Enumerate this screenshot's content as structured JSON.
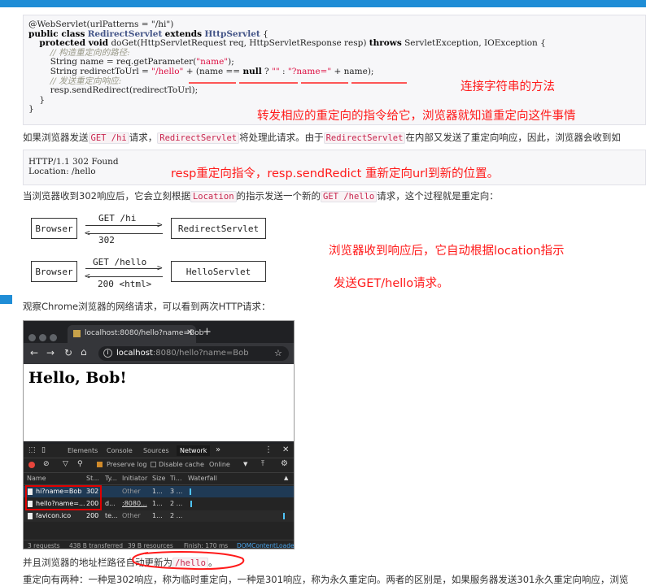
{
  "code1": {
    "l1": "@WebServlet(urlPatterns = \"/hi\")",
    "l2_kw": "public class",
    "l2_cls": "RedirectServlet",
    "l2_ext": "extends",
    "l2_base": "HttpServlet",
    "l2_end": " {",
    "l3_kw": "protected void",
    "l3_rest": " doGet(HttpServletRequest req, HttpServletResponse resp) ",
    "l3_throws": "throws",
    "l3_exc": " ServletException, IOException {",
    "l4": "// 构造重定向的路径:",
    "l5_a": "String name = req.getParameter(",
    "l5_s": "\"name\"",
    "l5_b": ");",
    "l6_a": "String redirectToUrl = ",
    "l6_s1": "\"/hello\"",
    "l6_b": " + (name == ",
    "l6_null": "null",
    "l6_c": " ? ",
    "l6_s2": "\"\"",
    "l6_d": " : ",
    "l6_s3": "\"?name=\"",
    "l6_e": " + name);",
    "l7": "// 发送重定向响应:",
    "l8": "resp.sendRedirect(redirectToUrl);",
    "l9": "}",
    "l10": "}"
  },
  "annotations": {
    "a1": "连接字符串的方法",
    "a2": "转发相应的重定向的指令给它，浏览器就知道重定向这件事情",
    "a3": "resp重定向指令，resp.sendRedict  重新定向url到新的位置。",
    "a4": "浏览器收到响应后，它自动根据location指示",
    "a5": "发送GET/hello请求。"
  },
  "para1": {
    "t1": "如果浏览器发送",
    "c1": "GET /hi",
    "t2": "请求，",
    "c2": "RedirectServlet",
    "t3": "将处理此请求。由于",
    "c3": "RedirectServlet",
    "t4": "在内部又发送了重定向响应，因此，浏览器会收到如"
  },
  "code2": {
    "l1": "HTTP/1.1 302 Found",
    "l2": "Location: /hello"
  },
  "para2": {
    "t1": "当浏览器收到302响应后，它会立刻根据",
    "c1": "Location",
    "t2": "的指示发送一个新的",
    "c2": "GET /hello",
    "t3": "请求，这个过程就是重定向："
  },
  "diagram": {
    "browser1": "Browser",
    "req1": "GET /hi",
    "resp1": "302",
    "server1": "RedirectServlet",
    "browser2": "Browser",
    "req2": "GET /hello",
    "resp2": "200 <html>",
    "server2": "HelloServlet"
  },
  "para3": "观察Chrome浏览器的网络请求，可以看到两次HTTP请求：",
  "browser": {
    "tab_title": "localhost:8080/hello?name=Bob",
    "url_host": "localhost",
    "url_rest": ":8080/hello?name=Bob",
    "page_heading": "Hello, Bob!",
    "devtools_tabs": [
      "Elements",
      "Console",
      "Sources",
      "Network"
    ],
    "active_tab": "Network",
    "more": "»",
    "preserve_log": "Preserve log",
    "disable_cache": "Disable cache",
    "throttle": "Online",
    "columns": [
      "Name",
      "St...",
      "Ty...",
      "Initiator",
      "Size",
      "Ti...",
      "Waterfall"
    ],
    "rows": [
      [
        "hi?name=Bob",
        "302",
        "",
        "Other",
        "1...",
        "3 ..."
      ],
      [
        "hello?name=...",
        "200",
        "d...",
        ":8080...",
        "1...",
        "2 ..."
      ],
      [
        "favicon.ico",
        "200",
        "te...",
        "Other",
        "1...",
        "2 ..."
      ]
    ],
    "status": {
      "requests": "3 requests",
      "transferred": "438 B transferred",
      "resources": "39 B resources",
      "finish": "Finish: 170 ms",
      "dcl": "DOMContentLoade"
    },
    "colors": {
      "accent": "#1a73e8",
      "chrome": "#202124",
      "highlight": "#e00000"
    }
  },
  "para4": {
    "t1": "并且浏览器的地址栏路径自动更新为",
    "c1": "/hello",
    "t2": "。"
  },
  "para5": "重定向有两种：一种是302响应，称为临时重定向，一种是301响应，称为永久重定向。两者的区别是，如果服务器发送301永久重定向响应，浏览"
}
